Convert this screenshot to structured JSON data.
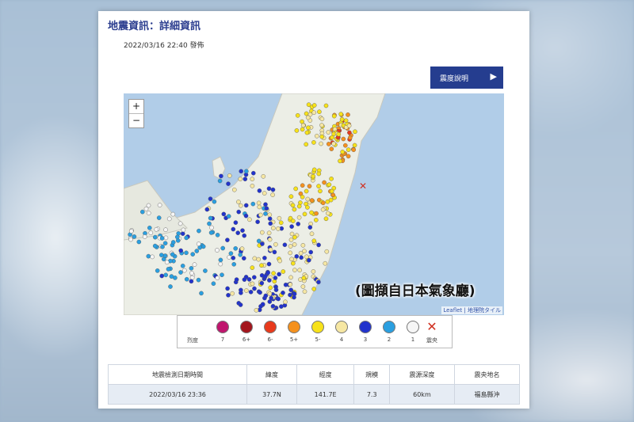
{
  "header": {
    "title": "地震資訊：詳細資訊",
    "issued": "2022/03/16 22:40 發佈",
    "explain_button": "震度說明"
  },
  "map": {
    "zoom_in": "+",
    "zoom_out": "−",
    "attribution": "Leaflet | 地理院タイル",
    "epicenter_marker": "✕"
  },
  "legend": {
    "title": "烈度",
    "levels": [
      {
        "label": "7",
        "color": "#c0166e"
      },
      {
        "label": "6+",
        "color": "#a3161d"
      },
      {
        "label": "6-",
        "color": "#e83a1c"
      },
      {
        "label": "5+",
        "color": "#f5911e"
      },
      {
        "label": "5-",
        "color": "#f7e21a"
      },
      {
        "label": "4",
        "color": "#f6e7a3"
      },
      {
        "label": "3",
        "color": "#2233cc"
      },
      {
        "label": "2",
        "color": "#2a9fe0"
      },
      {
        "label": "1",
        "color": "#f6f6f6"
      }
    ],
    "epicenter_label": "震央"
  },
  "table": {
    "headers": [
      "地震檢測日期時間",
      "緯度",
      "經度",
      "規模",
      "震源深度",
      "震央地名"
    ],
    "row": [
      "2022/03/16 23:36",
      "37.7N",
      "141.7E",
      "7.3",
      "60km",
      "福島縣沖"
    ]
  },
  "caption": "(圖擷自日本氣象廳)"
}
